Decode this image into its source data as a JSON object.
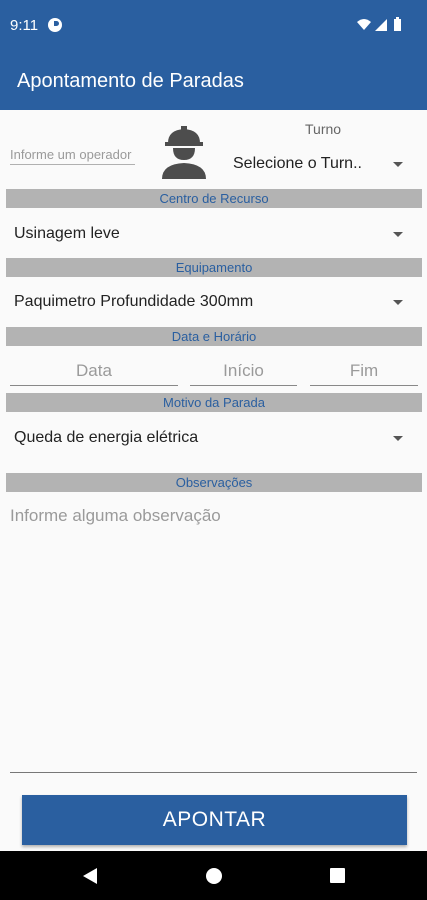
{
  "status_bar": {
    "time": "9:11"
  },
  "app_bar": {
    "title": "Apontamento de Paradas"
  },
  "operator": {
    "placeholder": "Informe um operador"
  },
  "turno": {
    "label": "Turno",
    "selected": "Selecione o Turn.."
  },
  "sections": {
    "centro_recurso": "Centro de Recurso",
    "equipamento": "Equipamento",
    "data_horario": "Data e Horário",
    "motivo": "Motivo da Parada",
    "observacoes": "Observações"
  },
  "centro_recurso": {
    "selected": "Usinagem leve"
  },
  "equipamento": {
    "selected": "Paquimetro Profundidade 300mm"
  },
  "data_horario": {
    "data_placeholder": "Data",
    "inicio_placeholder": "Início",
    "fim_placeholder": "Fim"
  },
  "motivo": {
    "selected": "Queda de energia elétrica"
  },
  "observacoes": {
    "placeholder": "Informe alguma observação"
  },
  "submit": {
    "label": "APONTAR"
  },
  "colors": {
    "primary": "#2a5fa0",
    "section_bg": "#b3b3b3",
    "nav_bg": "#000000"
  },
  "icons": [
    "status-app-icon",
    "wifi-icon",
    "signal-icon",
    "battery-icon",
    "worker-helmet-icon",
    "chevron-down-icon",
    "back-icon",
    "home-icon",
    "recents-icon"
  ]
}
